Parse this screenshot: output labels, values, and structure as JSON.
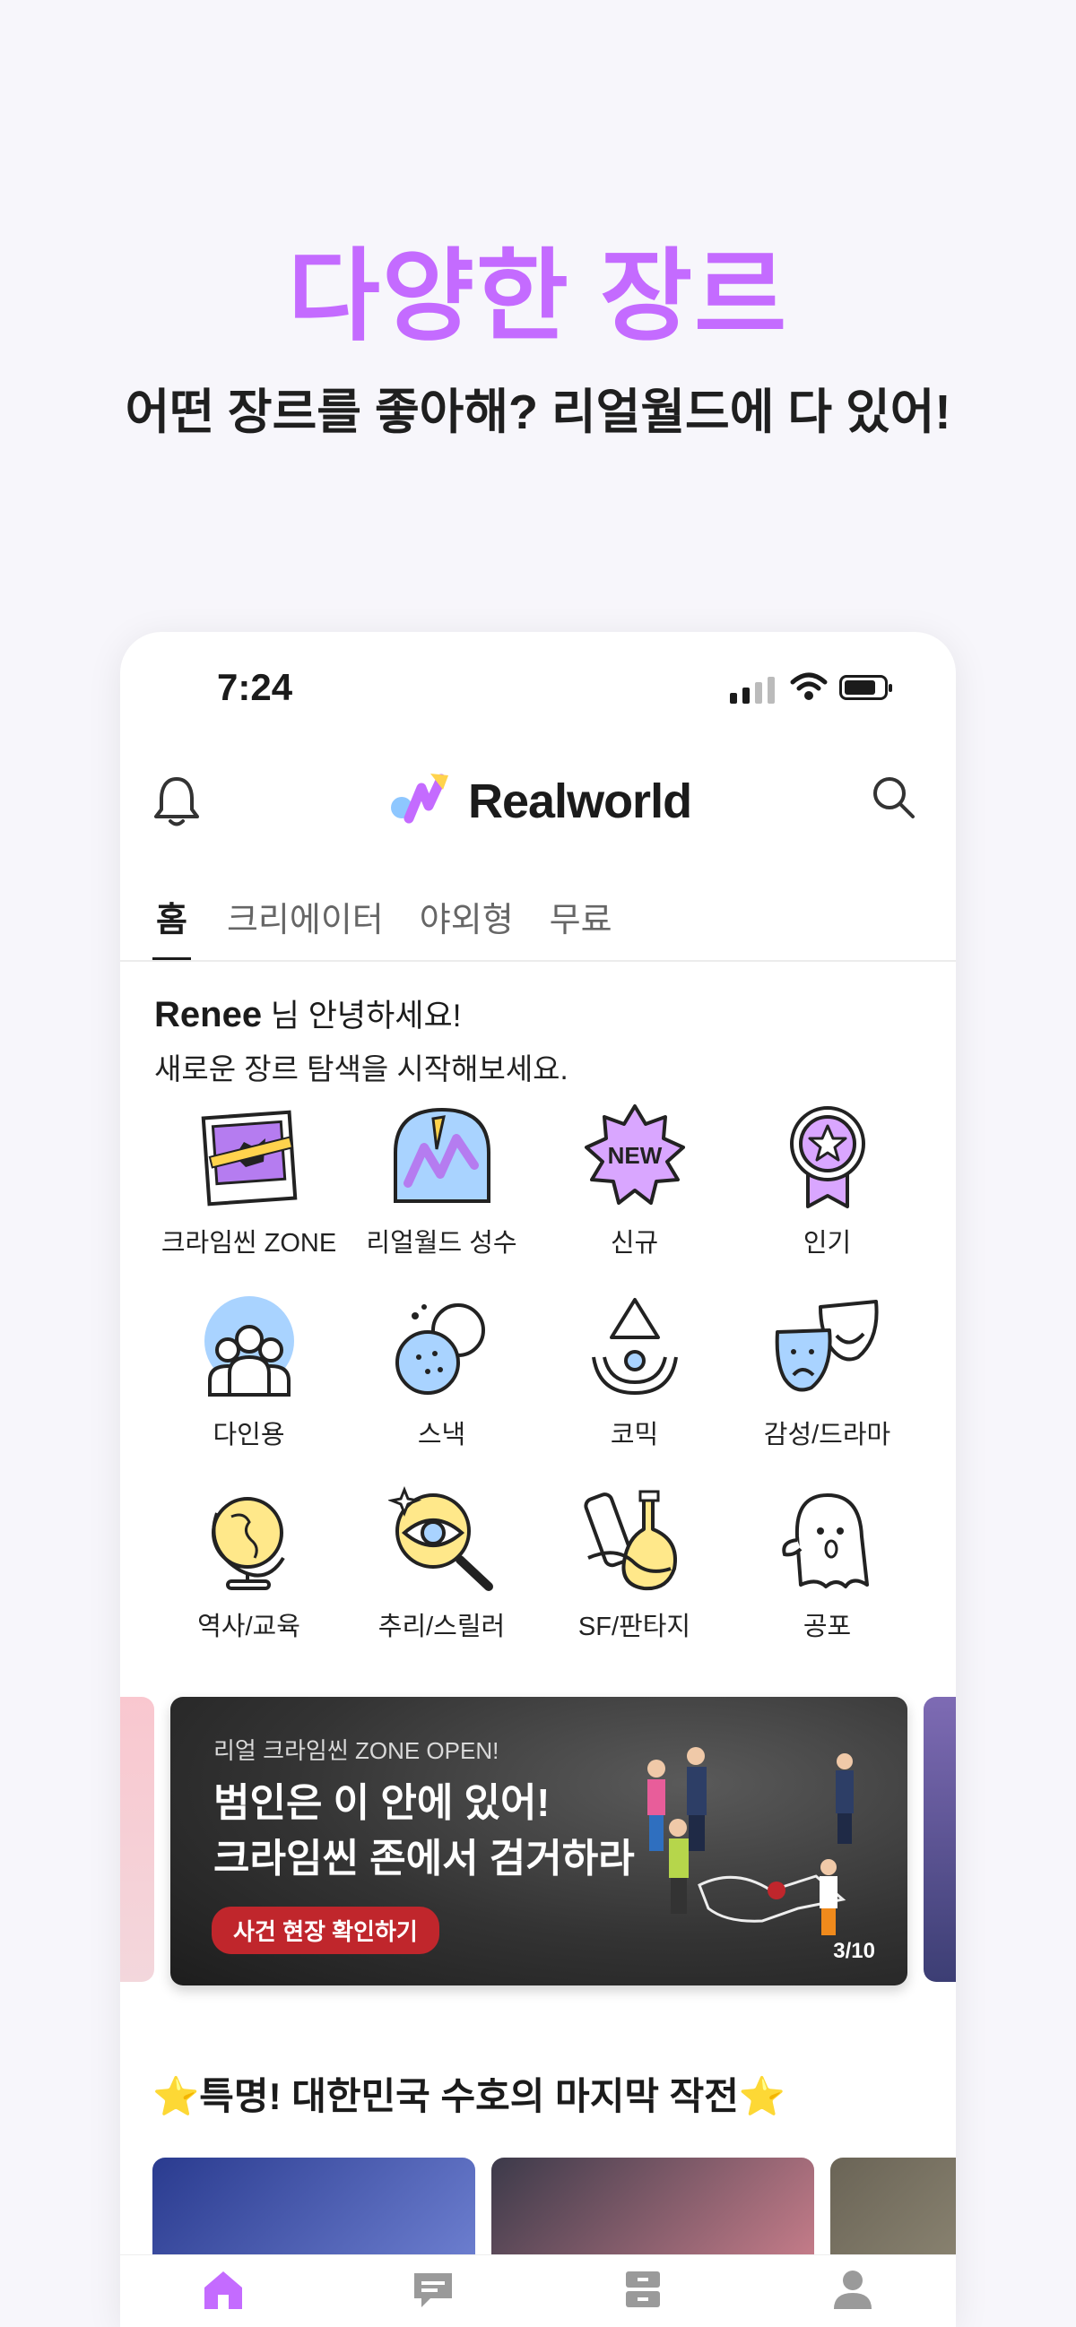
{
  "promo": {
    "headline": "다양한 장르",
    "subline": "어떤 장르를 좋아해? 리얼월드에 다 있어!"
  },
  "status_bar": {
    "time": "7:24"
  },
  "app": {
    "name": "Realworld",
    "accent_color": "#c46bff"
  },
  "tabs": [
    {
      "label": "홈",
      "active": true
    },
    {
      "label": "크리에이터",
      "active": false
    },
    {
      "label": "야외형",
      "active": false
    },
    {
      "label": "무료",
      "active": false
    }
  ],
  "greeting": {
    "user_name": "Renee",
    "suffix": " 님 안녕하세요!",
    "message": "새로운 장르 탐색을 시작해보세요."
  },
  "genres": [
    {
      "label": "크라임씬 ZONE",
      "icon": "crime-scene-photo-icon"
    },
    {
      "label": "리얼월드 성수",
      "icon": "realworld-seongsu-icon"
    },
    {
      "label": "신규",
      "icon": "new-badge-icon"
    },
    {
      "label": "인기",
      "icon": "popular-medal-icon"
    },
    {
      "label": "다인용",
      "icon": "multi-player-icon"
    },
    {
      "label": "스낵",
      "icon": "snack-cookie-icon"
    },
    {
      "label": "코믹",
      "icon": "comic-icon"
    },
    {
      "label": "감성/드라마",
      "icon": "drama-masks-icon"
    },
    {
      "label": "역사/교육",
      "icon": "globe-icon"
    },
    {
      "label": "추리/스릴러",
      "icon": "magnifier-eye-icon"
    },
    {
      "label": "SF/판타지",
      "icon": "sf-fantasy-scroll-icon"
    },
    {
      "label": "공포",
      "icon": "ghost-icon"
    }
  ],
  "banner": {
    "eyebrow": "리얼 크라임씬 ZONE OPEN!",
    "title_line1": "범인은 이 안에 있어!",
    "title_line2": "크라임씬 존에서 검거하라",
    "cta": "사건 현장 확인하기",
    "pager": "3/10"
  },
  "section": {
    "title": "⭐특명! 대한민국 수호의 마지막 작전⭐"
  },
  "bottom_nav": [
    {
      "icon": "home-icon",
      "active": true
    },
    {
      "icon": "chat-icon",
      "active": false
    },
    {
      "icon": "archive-icon",
      "active": false
    },
    {
      "icon": "profile-icon",
      "active": false
    }
  ]
}
